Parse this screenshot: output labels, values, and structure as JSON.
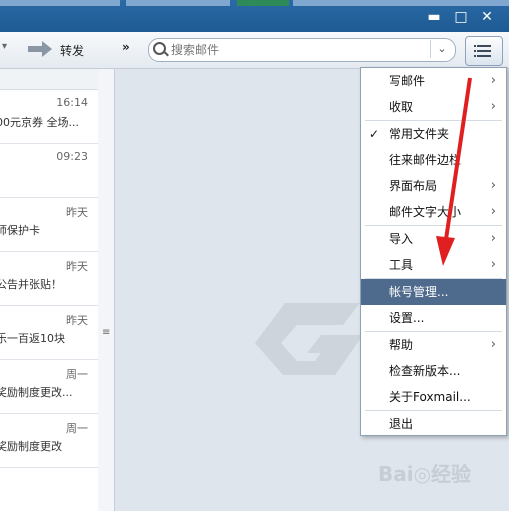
{
  "toolbar": {
    "forward_label": "转发",
    "more_label": "»",
    "search_placeholder": "搜索邮件",
    "window": {
      "minimize": "▬",
      "maximize": "□",
      "close": "✕"
    }
  },
  "mail_list": [
    {
      "time": "16:14",
      "preview": "00元京券 全场..."
    },
    {
      "time": "09:23",
      "preview": ""
    },
    {
      "time": "昨天",
      "preview": "师保护卡"
    },
    {
      "time": "昨天",
      "preview": "公告并张贴！"
    },
    {
      "time": "昨天",
      "preview": "乐一百返10块"
    },
    {
      "time": "周一",
      "preview": "奖励制度更改..."
    },
    {
      "time": "周一",
      "preview": "奖励制度更改"
    }
  ],
  "menu": {
    "items": [
      {
        "label": "写邮件"
      },
      {
        "label": "收取"
      },
      {
        "label": "常用文件夹"
      },
      {
        "label": "往来邮件边栏"
      },
      {
        "label": "界面布局"
      },
      {
        "label": "邮件文字大小"
      },
      {
        "label": "导入"
      },
      {
        "label": "工具"
      },
      {
        "label": "帐号管理..."
      },
      {
        "label": "设置..."
      },
      {
        "label": "帮助"
      },
      {
        "label": "检查新版本..."
      },
      {
        "label": "关于Foxmail..."
      },
      {
        "label": "退出"
      }
    ]
  },
  "watermark": "Bai◎经验",
  "colors": {
    "highlight": "#4e6a8c",
    "arrow": "#e02020",
    "titlebar": "#1e5a93"
  }
}
